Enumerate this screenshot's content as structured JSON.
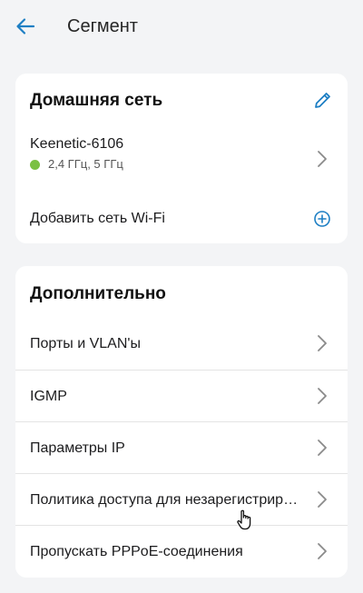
{
  "appbar": {
    "title": "Сегмент",
    "back_icon": "arrow-left-icon"
  },
  "home_network": {
    "header": "Домашняя сеть",
    "edit_icon": "pencil-icon",
    "network": {
      "name": "Keenetic-6106",
      "bands": "2,4 ГГц, 5 ГГц",
      "status_color": "#7bc043"
    },
    "add_wifi_label": "Добавить сеть Wi-Fi",
    "add_icon": "plus-circle-icon"
  },
  "advanced": {
    "header": "Дополнительно",
    "items": [
      {
        "label": "Порты и VLAN'ы"
      },
      {
        "label": "IGMP"
      },
      {
        "label": "Параметры IP"
      },
      {
        "label": "Политика доступа для незарегистрированных"
      },
      {
        "label": "Пропускать PPPoE-соединения"
      }
    ]
  },
  "colors": {
    "accent": "#1e7fc4",
    "background": "#f3f4f6",
    "card": "#ffffff"
  }
}
